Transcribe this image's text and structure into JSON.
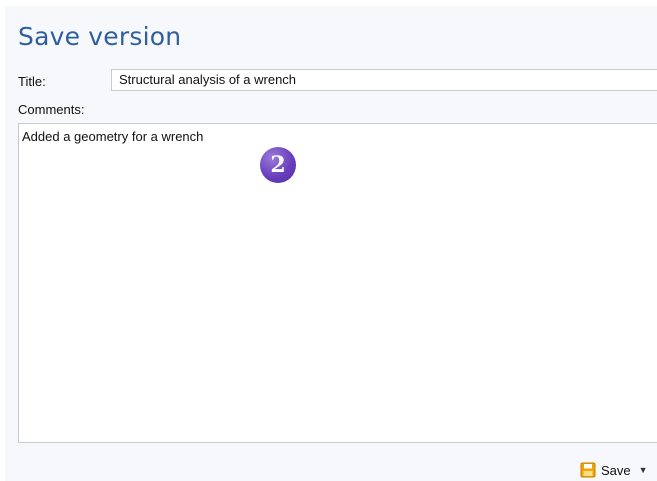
{
  "dialog": {
    "heading": "Save version",
    "title_label": "Title:",
    "title_value": "Structural analysis of a wrench",
    "comments_label": "Comments:",
    "comments_value": "Added a geometry for a wrench",
    "step_marker": "2"
  },
  "footer": {
    "save_label": "Save",
    "save_icon": "floppy-disk-icon",
    "dropdown_icon": "chevron-down-icon"
  },
  "colors": {
    "heading": "#2f5f9e",
    "panel_background": "#f6f8fb",
    "step_badge": "#6a3fbf",
    "save_icon": "#e8a317"
  }
}
